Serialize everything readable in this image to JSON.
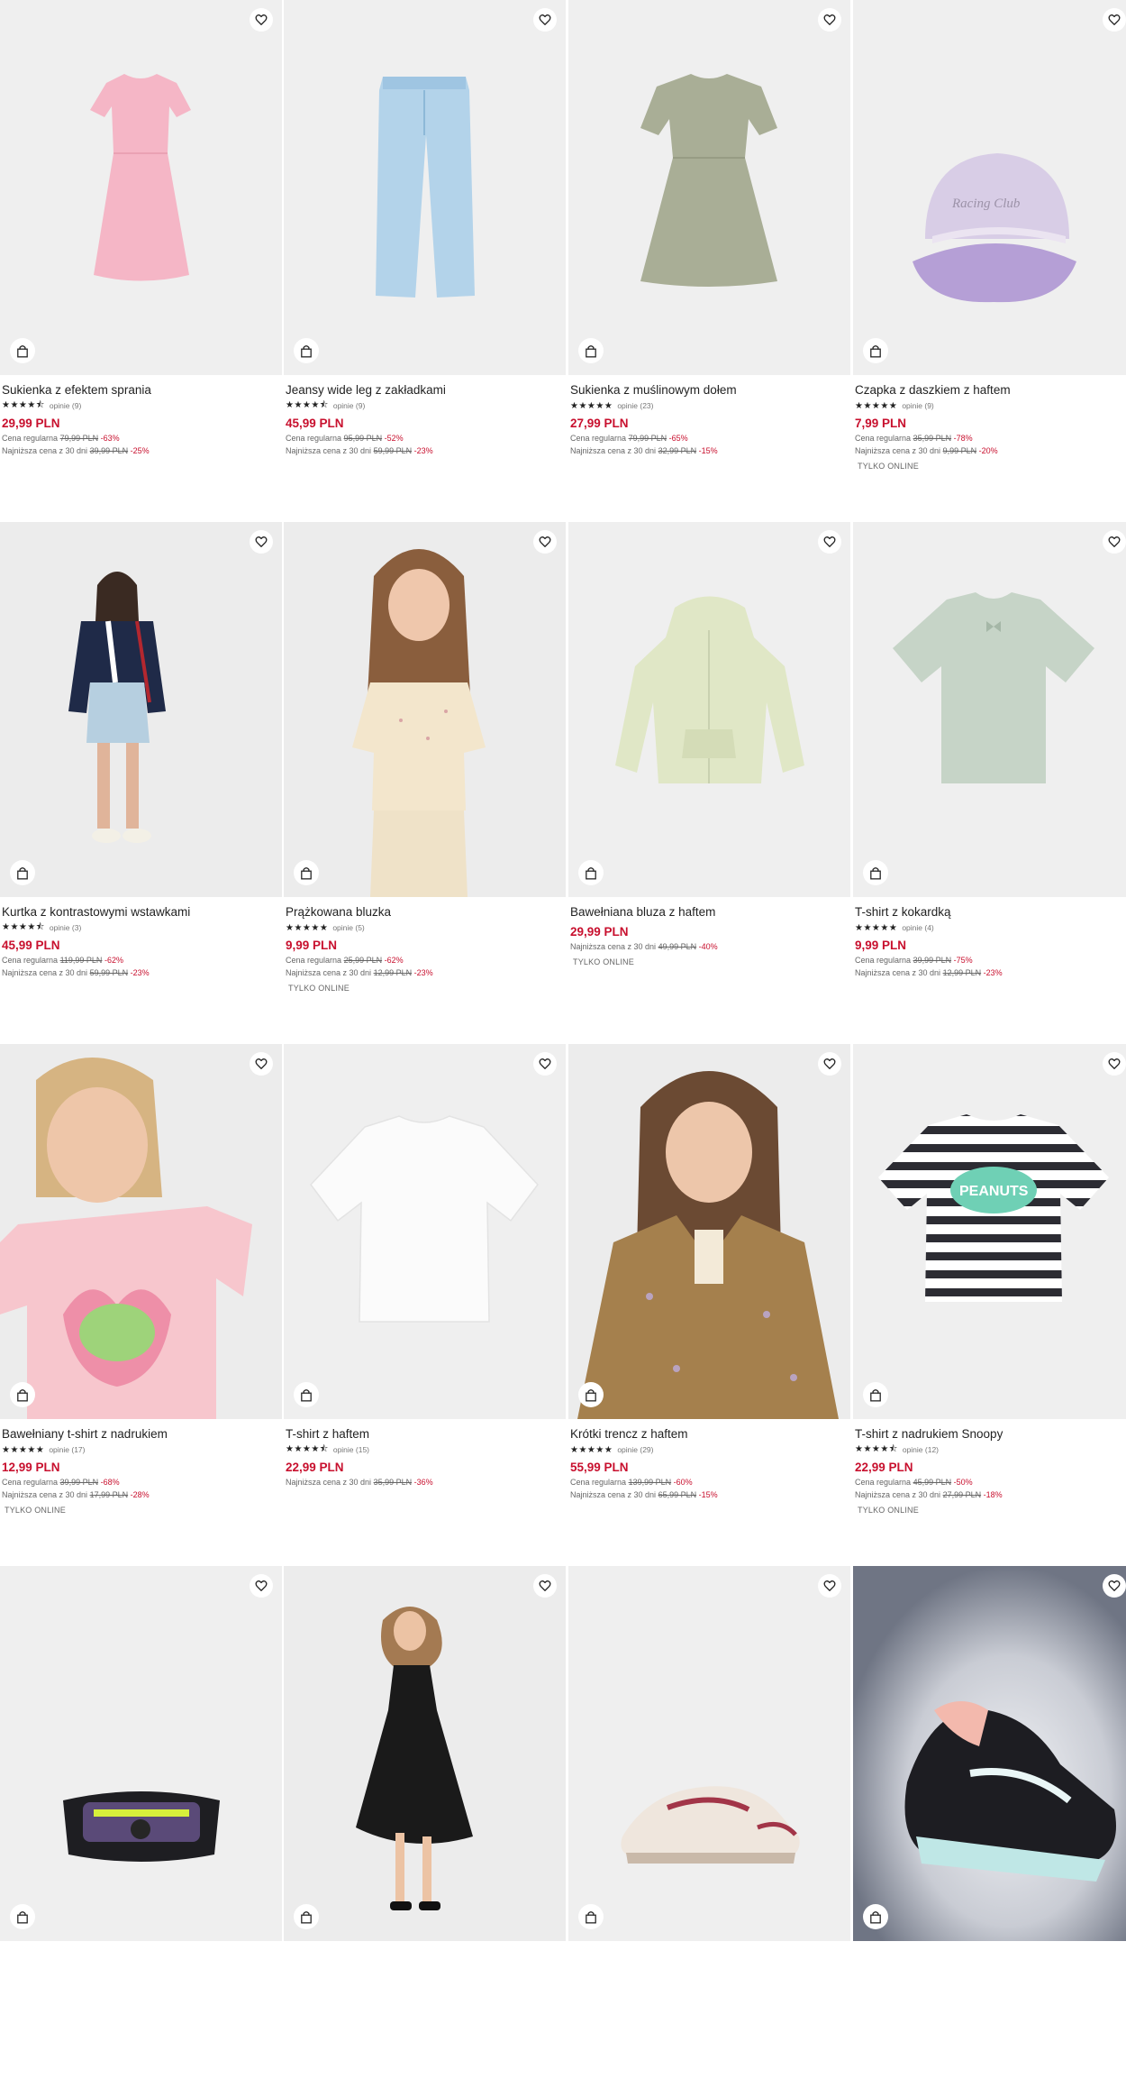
{
  "labels": {
    "regular": "Cena regularna",
    "lowest": "Najniższa cena z 30 dni",
    "online": "TYLKO ONLINE"
  },
  "products": [
    {
      "name": "Sukienka z efektem sprania",
      "rating": 4.5,
      "reviews": "opinie (9)",
      "price": "29,99 PLN",
      "regular": "79,99 PLN",
      "regular_pct": "-63%",
      "lowest": "39,99 PLN",
      "lowest_pct": "-25%",
      "online": false
    },
    {
      "name": "Jeansy wide leg z zakładkami",
      "rating": 4.5,
      "reviews": "opinie (9)",
      "price": "45,99 PLN",
      "regular": "95,99 PLN",
      "regular_pct": "-52%",
      "lowest": "59,99 PLN",
      "lowest_pct": "-23%",
      "online": false
    },
    {
      "name": "Sukienka z muślinowym dołem",
      "rating": 5,
      "reviews": "opinie (23)",
      "price": "27,99 PLN",
      "regular": "79,99 PLN",
      "regular_pct": "-65%",
      "lowest": "32,99 PLN",
      "lowest_pct": "-15%",
      "online": false
    },
    {
      "name": "Czapka z daszkiem z haftem",
      "rating": 5,
      "reviews": "opinie (9)",
      "price": "7,99 PLN",
      "regular": "35,99 PLN",
      "regular_pct": "-78%",
      "lowest": "9,99 PLN",
      "lowest_pct": "-20%",
      "online": true
    },
    {
      "name": "Kurtka z kontrastowymi wstawkami",
      "rating": 4.5,
      "reviews": "opinie (3)",
      "price": "45,99 PLN",
      "regular": "119,99 PLN",
      "regular_pct": "-62%",
      "lowest": "59,99 PLN",
      "lowest_pct": "-23%",
      "online": false
    },
    {
      "name": "Prążkowana bluzka",
      "rating": 5,
      "reviews": "opinie (5)",
      "price": "9,99 PLN",
      "regular": "25,99 PLN",
      "regular_pct": "-62%",
      "lowest": "12,99 PLN",
      "lowest_pct": "-23%",
      "online": true
    },
    {
      "name": "Bawełniana bluza z haftem",
      "rating": null,
      "reviews": "",
      "price": "29,99 PLN",
      "regular": "",
      "regular_pct": "",
      "lowest": "49,99 PLN",
      "lowest_pct": "-40%",
      "online": true
    },
    {
      "name": "T-shirt z kokardką",
      "rating": 5,
      "reviews": "opinie (4)",
      "price": "9,99 PLN",
      "regular": "39,99 PLN",
      "regular_pct": "-75%",
      "lowest": "12,99 PLN",
      "lowest_pct": "-23%",
      "online": false
    },
    {
      "name": "Bawełniany t-shirt z nadrukiem",
      "rating": 5,
      "reviews": "opinie (17)",
      "price": "12,99 PLN",
      "regular": "39,99 PLN",
      "regular_pct": "-68%",
      "lowest": "17,99 PLN",
      "lowest_pct": "-28%",
      "online": true
    },
    {
      "name": "T-shirt z haftem",
      "rating": 4.5,
      "reviews": "opinie (15)",
      "price": "22,99 PLN",
      "regular": "",
      "regular_pct": "",
      "lowest": "35,99 PLN",
      "lowest_pct": "-36%",
      "online": false
    },
    {
      "name": "Krótki trencz z haftem",
      "rating": 5,
      "reviews": "opinie (29)",
      "price": "55,99 PLN",
      "regular": "139,99 PLN",
      "regular_pct": "-60%",
      "lowest": "65,99 PLN",
      "lowest_pct": "-15%",
      "online": false
    },
    {
      "name": "T-shirt z nadrukiem Snoopy",
      "rating": 4.5,
      "reviews": "opinie (12)",
      "price": "22,99 PLN",
      "regular": "45,99 PLN",
      "regular_pct": "-50%",
      "lowest": "27,99 PLN",
      "lowest_pct": "-18%",
      "online": true
    },
    {
      "name": "",
      "rating": null,
      "reviews": "",
      "price": "",
      "regular": "",
      "regular_pct": "",
      "lowest": "",
      "lowest_pct": "",
      "online": false
    },
    {
      "name": "",
      "rating": null,
      "reviews": "",
      "price": "",
      "regular": "",
      "regular_pct": "",
      "lowest": "",
      "lowest_pct": "",
      "online": false
    },
    {
      "name": "",
      "rating": null,
      "reviews": "",
      "price": "",
      "regular": "",
      "regular_pct": "",
      "lowest": "",
      "lowest_pct": "",
      "online": false
    },
    {
      "name": "",
      "rating": null,
      "reviews": "",
      "price": "",
      "regular": "",
      "regular_pct": "",
      "lowest": "",
      "lowest_pct": "",
      "online": false
    }
  ],
  "icons": {
    "favorite": "heart-icon",
    "add_to_cart": "shopping-bag-icon"
  },
  "colors": {
    "sale_price": "#c8102e",
    "text": "#222222",
    "muted": "#666666"
  }
}
